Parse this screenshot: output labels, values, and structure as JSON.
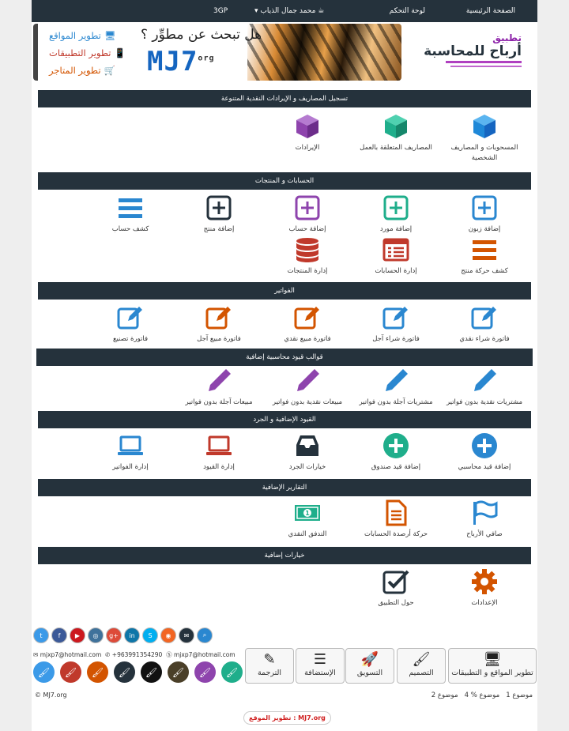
{
  "topnav": {
    "home": "الصفحة الرئيسية",
    "dashboard": "لوحة التحكم",
    "user": "محمد جمال الذياب",
    "app": "3GP"
  },
  "brand": {
    "prefix": "تطبيق",
    "name": "أرباح للمحاسبة"
  },
  "banner": {
    "question": "هل تبحث عن مطوِّر ؟",
    "logo": "MJ7",
    "logo_suffix": "org",
    "links": [
      "تطوير المواقع",
      "تطوير التطبيقات",
      "تطوير المتاجر"
    ]
  },
  "sections": [
    {
      "title": "تسجيل المصاريف و الإيرادات النقدية المتنوعة",
      "items": [
        "المسحوبات و المصاريف الشخصية",
        "المصاريف المتعلقة بالعمل",
        "الإيرادات"
      ]
    },
    {
      "title": "الحسابات و المنتجات",
      "items": [
        "إضافة زبون",
        "إضافة مورد",
        "إضافة حساب",
        "إضافة منتج",
        "كشف حساب",
        "كشف حركة منتج",
        "إدارة الحسابات",
        "إدارة المنتجات"
      ]
    },
    {
      "title": "الفواتير",
      "items": [
        "فاتورة شراء نقدي",
        "فاتورة شراء آجل",
        "فاتورة مبيع نقدي",
        "فاتورة مبيع آجل",
        "فاتورة تصنيع"
      ]
    },
    {
      "title": "قوالب قيود محاسبية إضافية",
      "items": [
        "مشتريات نقدية بدون فواتير",
        "مشتريات آجلة بدون فواتير",
        "مبيعات نقدية بدون فواتير",
        "مبيعات آجلة بدون فواتير"
      ]
    },
    {
      "title": "القيود الإضافية و الجرد",
      "items": [
        "إضافة قيد محاسبي",
        "إضافة قيد صندوق",
        "خيارات الجرد",
        "إدارة القيود",
        "إدارة الفواتير"
      ]
    },
    {
      "title": "التقارير الإضافية",
      "items": [
        "صافي الأرباح",
        "حركة أرصدة الحسابات",
        "التدفق النقدي"
      ]
    },
    {
      "title": "خيارات إضافية",
      "items": [
        "الإعدادات",
        "حول التطبيق"
      ]
    }
  ],
  "footer": {
    "contacts": [
      "mjxp7@hotmail.com",
      "+963991354290",
      "mjxp7@hotmail.com"
    ],
    "buttons": [
      "تطوير المواقع و التطبيقات",
      "التصميم",
      "التسويق",
      "الإستضافة",
      "الترجمة"
    ],
    "stats": {
      "t1": "موضوع 1",
      "t2": "موضوع % 4",
      "t3": "موضوع 2"
    },
    "copyright": "© MJ7.org",
    "credit": "تطوير الموقع : MJ7.org"
  },
  "colors": {
    "navy": "#25323c",
    "blue": "#2a87d0",
    "teal": "#1fae8b",
    "purple": "#8e44ad",
    "orange": "#d35400",
    "red": "#c0392b"
  }
}
